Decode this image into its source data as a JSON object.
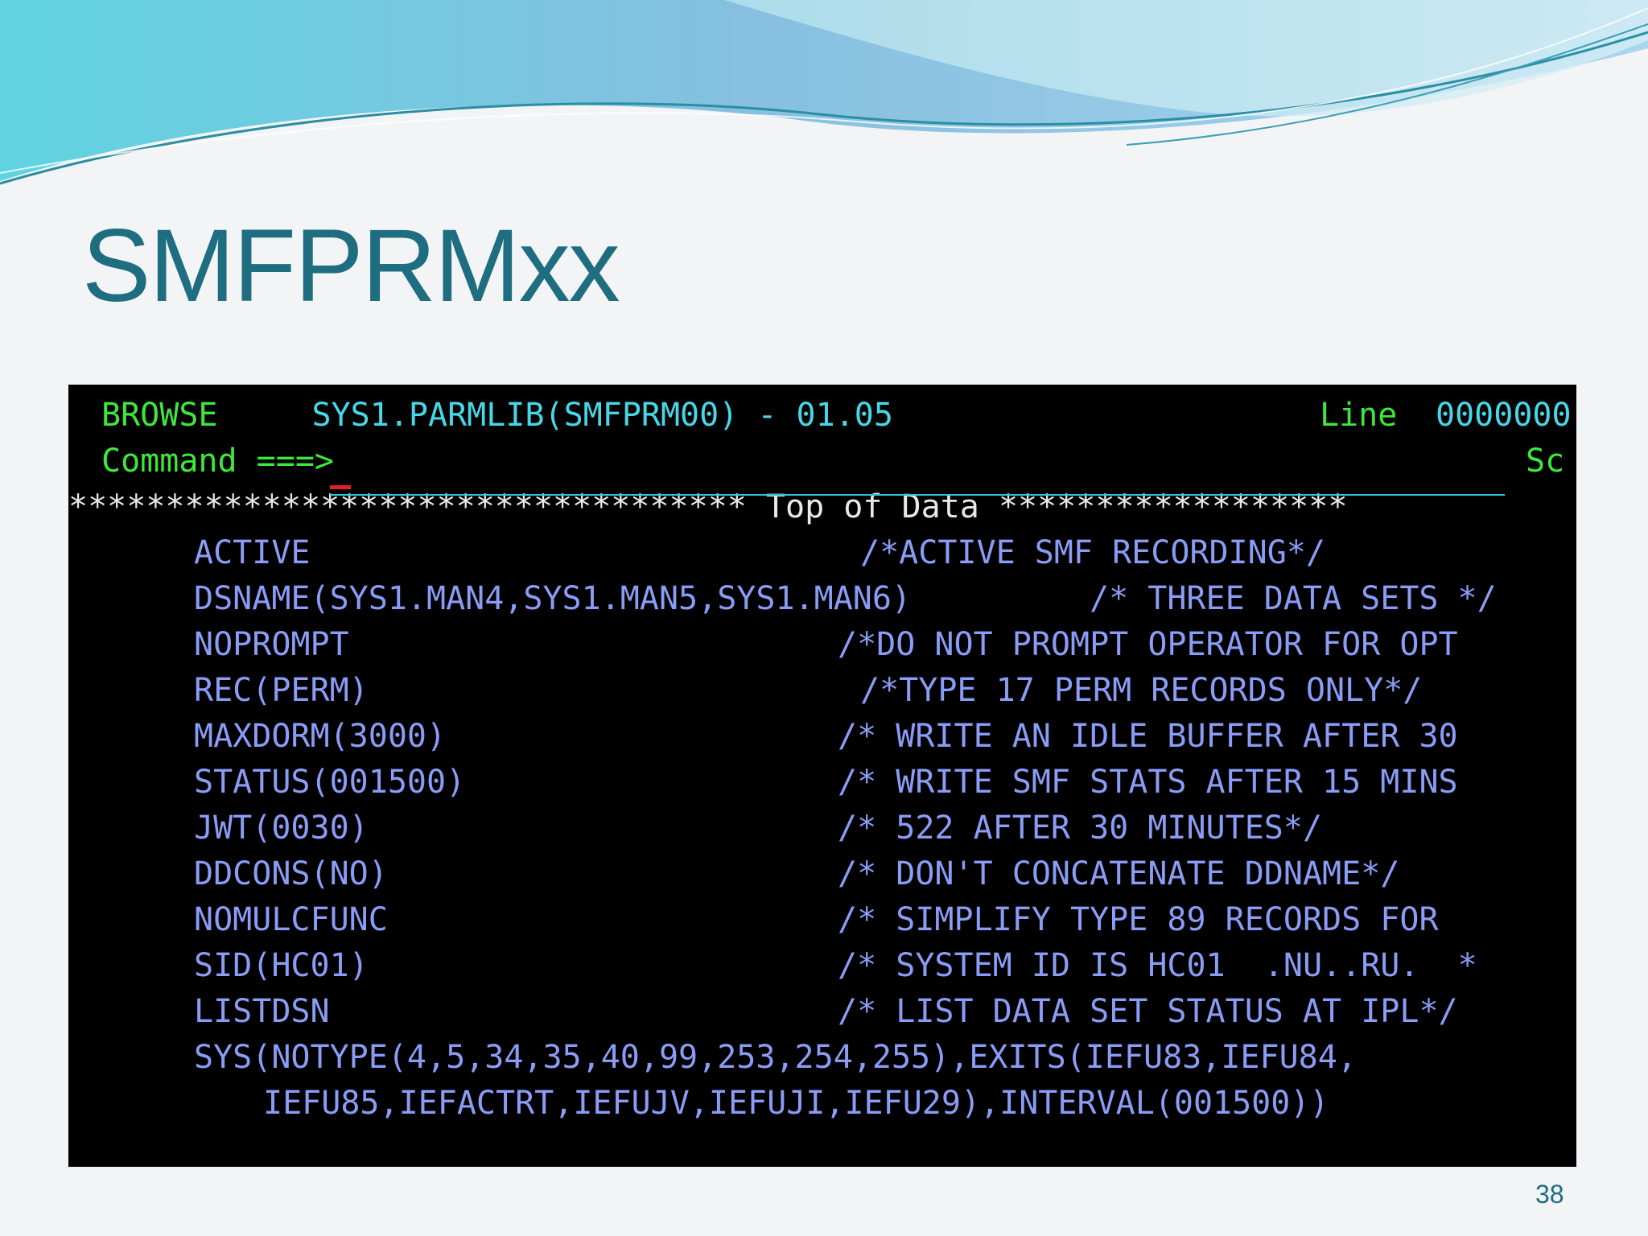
{
  "slide": {
    "title": "SMFPRMxx",
    "page_number": "38",
    "colors": {
      "title": "#1f6d80",
      "terminal_bg": "#000000",
      "green": "#3ee83a",
      "turquoise": "#46d8e8",
      "blue": "#8a9cf6",
      "white": "#e8e8e8"
    }
  },
  "terminal": {
    "header": {
      "mode": "BROWSE",
      "dataset": "SYS1.PARMLIB(SMFPRM00) - 01.05",
      "line_label": "Line",
      "line_value": "0000000"
    },
    "command": {
      "label": "Command ===>",
      "value": "",
      "scroll_label": "Sc"
    },
    "top_of_data": "*********************************** Top of Data ******************",
    "lines": [
      {
        "param": "ACTIVE",
        "comment": "/*ACTIVE SMF RECORDING*/"
      },
      {
        "param": "DSNAME(SYS1.MAN4,SYS1.MAN5,SYS1.MAN6)",
        "comment": "/* THREE DATA SETS */"
      },
      {
        "param": "NOPROMPT",
        "comment": "/*DO NOT PROMPT OPERATOR FOR OPT"
      },
      {
        "param": "REC(PERM)",
        "comment": "/*TYPE 17 PERM RECORDS ONLY*/"
      },
      {
        "param": "MAXDORM(3000)",
        "comment": "/* WRITE AN IDLE BUFFER AFTER 30"
      },
      {
        "param": "STATUS(001500)",
        "comment": "/* WRITE SMF STATS AFTER 15 MINS"
      },
      {
        "param": "JWT(0030)",
        "comment": "/* 522 AFTER 30 MINUTES*/"
      },
      {
        "param": "DDCONS(NO)",
        "comment": "/* DON'T CONCATENATE DDNAME*/"
      },
      {
        "param": "NOMULCFUNC",
        "comment": "/* SIMPLIFY TYPE 89 RECORDS FOR"
      },
      {
        "param": "SID(HC01)",
        "comment": "/* SYSTEM ID IS HC01  .NU..RU.  *"
      },
      {
        "param": "LISTDSN",
        "comment": "/* LIST DATA SET STATUS AT IPL*/"
      }
    ],
    "sys_line_1": "SYS(NOTYPE(4,5,34,35,40,99,253,254,255),EXITS(IEFU83,IEFU84,",
    "sys_line_2": "IEFU85,IEFACTRT,IEFUJV,IEFUJI,IEFU29),INTERVAL(001500))"
  }
}
